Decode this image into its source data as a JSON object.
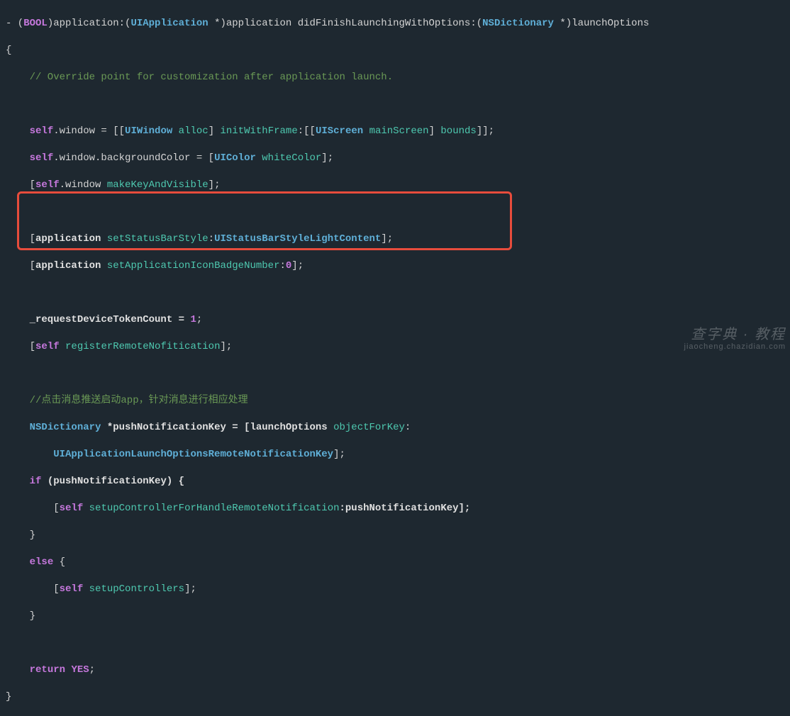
{
  "code": {
    "l1_dash": "- (",
    "l1_bool": "BOOL",
    "l1_p2": ")application:(",
    "l1_uiapp": "UIApplication",
    "l1_p3": " *)application didFinishLaunchingWithOptions:(",
    "l1_nsdict": "NSDictionary",
    "l1_p4": " *)launchOptions",
    "l2_brace": "{",
    "l3_comment": "    // Override point for customization after application launch.",
    "l5_pre": "    ",
    "l5_self": "self",
    "l5_p1": ".window = [[",
    "l5_uiwin": "UIWindow",
    "l5_p2": " ",
    "l5_alloc": "alloc",
    "l5_p3": "] ",
    "l5_init": "initWithFrame",
    "l5_p4": ":[[",
    "l5_uiscreen": "UIScreen",
    "l5_p5": " ",
    "l5_main": "mainScreen",
    "l5_p6": "] ",
    "l5_bounds": "bounds",
    "l5_p7": "]];",
    "l6_pre": "    ",
    "l6_self": "self",
    "l6_p1": ".window.backgroundColor = [",
    "l6_uicolor": "UIColor",
    "l6_p2": " ",
    "l6_white": "whiteColor",
    "l6_p3": "];",
    "l7_pre": "    [",
    "l7_self": "self",
    "l7_p1": ".window ",
    "l7_make": "makeKeyAndVisible",
    "l7_p2": "];",
    "l9_pre": "    [",
    "l9_app": "application",
    "l9_p1": " ",
    "l9_status": "setStatusBarStyle",
    "l9_p2": ":",
    "l9_style": "UIStatusBarStyleLightContent",
    "l9_p3": "];",
    "l10_pre": "    [",
    "l10_app": "application",
    "l10_p1": " ",
    "l10_badge": "setApplicationIconBadgeNumber",
    "l10_p2": ":",
    "l10_zero": "0",
    "l10_p3": "];",
    "l12_pre": "    _requestDeviceTokenCount = ",
    "l12_one": "1",
    "l12_p1": ";",
    "l13_pre": "    [",
    "l13_self": "self",
    "l13_p1": " ",
    "l13_reg": "registerRemoteNofitication",
    "l13_p2": "];",
    "l15_comment": "    //点击消息推送启动app，针对消息进行相应处理",
    "l16_pre": "    ",
    "l16_nsdict": "NSDictionary",
    "l16_p1": " *pushNotificationKey = [launchOptions ",
    "l16_obj": "objectForKey",
    "l16_p2": ":",
    "l17_pre": "        ",
    "l17_key": "UIApplicationLaunchOptionsRemoteNotificationKey",
    "l17_p1": "];",
    "l18_pre": "    ",
    "l18_if": "if",
    "l18_p1": " (pushNotificationKey) {",
    "l19_pre": "        [",
    "l19_self": "self",
    "l19_p1": " ",
    "l19_setup": "setupControllerForHandleRemoteNotification",
    "l19_p2": ":pushNotificationKey];",
    "l20_brace": "    }",
    "l21_pre": "    ",
    "l21_else": "else",
    "l21_p1": " {",
    "l22_pre": "        [",
    "l22_self": "self",
    "l22_p1": " ",
    "l22_setup": "setupControllers",
    "l22_p2": "];",
    "l23_brace": "    }",
    "l25_pre": "    ",
    "l25_ret": "return",
    "l25_p1": " ",
    "l25_yes": "YES",
    "l25_p2": ";",
    "l26_brace": "}"
  },
  "watermark": {
    "main": "查字典 · 教程",
    "sub": "jiaocheng.chazidian.com"
  },
  "highlight": {
    "color": "#e74c3c"
  }
}
